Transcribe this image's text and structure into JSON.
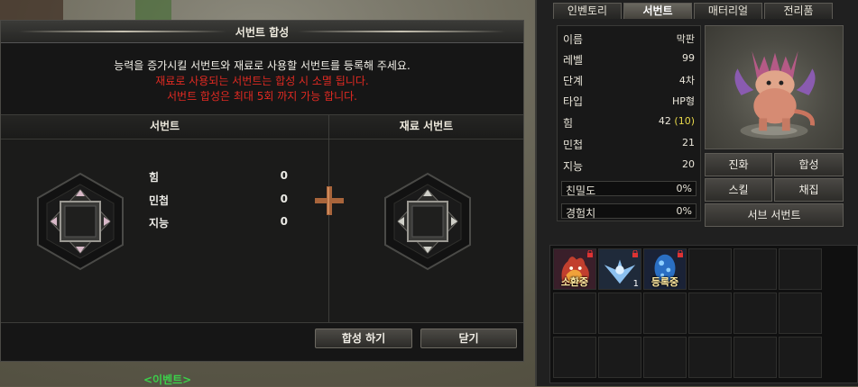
{
  "dialog": {
    "title": "서번트 합성",
    "message": "능력을 증가시킬 서번트와 재료로 사용할 서번트를 등록해 주세요.",
    "warning1": "재료로 사용되는 서번트는 합성 시 소멸 됩니다.",
    "warning2": "서번트 합성은 최대 5회 까지 가능 합니다.",
    "col_servant": "서번트",
    "col_material": "재료 서번트",
    "stats": [
      {
        "label": "힘",
        "value": "0"
      },
      {
        "label": "민첩",
        "value": "0"
      },
      {
        "label": "지능",
        "value": "0"
      }
    ],
    "synth_button": "합성 하기",
    "close_button": "닫기"
  },
  "event_text": "<이벤트>",
  "side": {
    "tabs": [
      {
        "label": "인벤토리"
      },
      {
        "label": "서번트"
      },
      {
        "label": "매터리얼"
      },
      {
        "label": "전리품"
      }
    ],
    "active_tab": "서번트",
    "info": [
      {
        "k": "이름",
        "v": "막판"
      },
      {
        "k": "레벨",
        "v": "99"
      },
      {
        "k": "단계",
        "v": "4차"
      },
      {
        "k": "타입",
        "v": "HP형"
      }
    ],
    "str": {
      "k": "힘",
      "v": "42",
      "bonus": "(10)"
    },
    "info2": [
      {
        "k": "민첩",
        "v": "21"
      },
      {
        "k": "지능",
        "v": "20"
      }
    ],
    "intimacy": {
      "k": "친밀도",
      "v": "0%"
    },
    "exp": {
      "k": "경험치",
      "v": "0%"
    },
    "buttons": {
      "evolve": "진화",
      "synth": "합성",
      "skill": "스킬",
      "gather": "채집",
      "sub": "서브 서번트"
    },
    "inventory": [
      {
        "caption": "소환중",
        "count": ""
      },
      {
        "caption": "",
        "count": "1"
      },
      {
        "caption": "등록중",
        "count": ""
      }
    ]
  },
  "colors": {
    "warning": "#e02a22",
    "event": "#3bd04a",
    "bonus": "#e8d84a"
  }
}
